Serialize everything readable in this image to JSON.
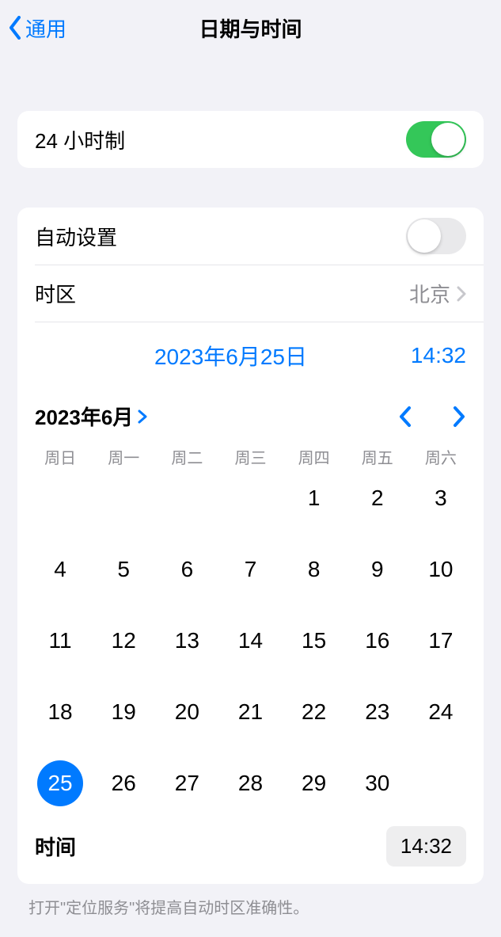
{
  "nav": {
    "back_label": "通用",
    "title": "日期与时间"
  },
  "settings": {
    "clock24h": {
      "label": "24 小时制",
      "on": true
    },
    "autoset": {
      "label": "自动设置",
      "on": false
    },
    "timezone": {
      "label": "时区",
      "value": "北京"
    }
  },
  "summary": {
    "date": "2023年6月25日",
    "time": "14:32"
  },
  "calendar": {
    "month_label": "2023年6月",
    "weekdays": [
      "周日",
      "周一",
      "周二",
      "周三",
      "周四",
      "周五",
      "周六"
    ],
    "leading_blanks": 4,
    "days_in_month": 30,
    "selected_day": 25,
    "time_label": "时间",
    "time_value": "14:32"
  },
  "footer": {
    "note": "打开\"定位服务\"将提高自动时区准确性。"
  },
  "colors": {
    "tint": "#007aff",
    "green": "#34c759"
  }
}
